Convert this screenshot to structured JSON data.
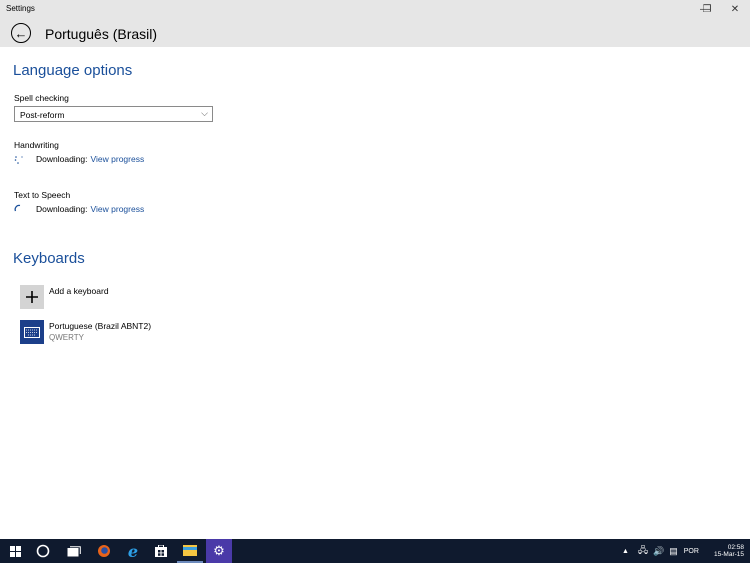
{
  "window": {
    "title": "Settings",
    "minimize_glyph": "—",
    "maximize_glyph": "❐",
    "close_glyph": "✕"
  },
  "header": {
    "back_glyph": "←",
    "title": "Português (Brasil)"
  },
  "language_options": {
    "title": "Language options",
    "spell_checking": {
      "label": "Spell checking",
      "selected": "Post-reform",
      "chevron": "⌵"
    },
    "handwriting": {
      "label": "Handwriting",
      "status": "Downloading:",
      "link": "View progress"
    },
    "text_to_speech": {
      "label": "Text to Speech",
      "status": "Downloading:",
      "link": "View progress"
    }
  },
  "keyboards": {
    "title": "Keyboards",
    "add_label": "Add a keyboard",
    "items": [
      {
        "name": "Portuguese (Brazil ABNT2)",
        "layout": "QWERTY"
      }
    ]
  },
  "taskbar": {
    "items": [
      "start",
      "cortana",
      "task-view",
      "firefox",
      "edge",
      "store",
      "file-explorer",
      "settings"
    ],
    "tray": {
      "language": "POR",
      "time": "02:58",
      "date": "15-Mar-15"
    }
  },
  "colors": {
    "accent": "#1a4f9a",
    "keyboard_tile": "#1c3f8a",
    "taskbar": "#0f1a2e",
    "settings_active": "#4a3aa8"
  }
}
